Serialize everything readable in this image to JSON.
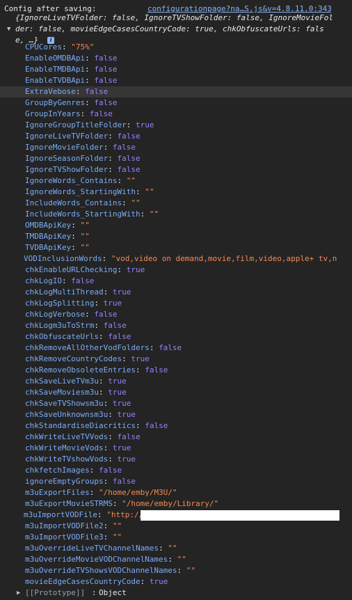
{
  "header": {
    "title": "Config after saving:",
    "source_link": "configurationpage?na…S.js&v=4.8.11.0:343"
  },
  "preview": {
    "line1": "{IgnoreLiveTVFolder: false, IgnoreTVShowFolder: false, IgnoreMovieFol",
    "line2": "der: false, movieEdgeCasesCountryCode: true, chkObfuscateUrls: fals",
    "line3": "e, …}",
    "info_icon": "i"
  },
  "properties": [
    {
      "key": "CPUCores",
      "value": "\"75%\"",
      "type": "str"
    },
    {
      "key": "EnableOMDBApi",
      "value": "false",
      "type": "bool"
    },
    {
      "key": "EnableTMDBApi",
      "value": "false",
      "type": "bool"
    },
    {
      "key": "EnableTVDBApi",
      "value": "false",
      "type": "bool"
    },
    {
      "key": "ExtraVebose",
      "value": "false",
      "type": "bool"
    },
    {
      "key": "GroupByGenres",
      "value": "false",
      "type": "bool"
    },
    {
      "key": "GroupInYears",
      "value": "false",
      "type": "bool"
    },
    {
      "key": "IgnoreGroupTitleFolder",
      "value": "true",
      "type": "bool"
    },
    {
      "key": "IgnoreLiveTVFolder",
      "value": "false",
      "type": "bool"
    },
    {
      "key": "IgnoreMovieFolder",
      "value": "false",
      "type": "bool"
    },
    {
      "key": "IgnoreSeasonFolder",
      "value": "false",
      "type": "bool"
    },
    {
      "key": "IgnoreTVShowFolder",
      "value": "false",
      "type": "bool"
    },
    {
      "key": "IgnoreWords_Contains",
      "value": "\"\"",
      "type": "str"
    },
    {
      "key": "IgnoreWords_StartingWith",
      "value": "\"\"",
      "type": "str"
    },
    {
      "key": "IncludeWords_Contains",
      "value": "\"\"",
      "type": "str"
    },
    {
      "key": "IncludeWords_StartingWith",
      "value": "\"\"",
      "type": "str"
    },
    {
      "key": "OMDBApiKey",
      "value": "\"\"",
      "type": "str"
    },
    {
      "key": "TMDBApiKey",
      "value": "\"\"",
      "type": "str"
    },
    {
      "key": "TVDBApiKey",
      "value": "\"\"",
      "type": "str"
    },
    {
      "key": "VODInclusionWords",
      "value": "\"vod,video on demand,movie,film,video,apple+ tv,n",
      "type": "str"
    },
    {
      "key": "chkEnableURLChecking",
      "value": "true",
      "type": "bool"
    },
    {
      "key": "chkLogIO",
      "value": "false",
      "type": "bool"
    },
    {
      "key": "chkLogMultiThread",
      "value": "true",
      "type": "bool"
    },
    {
      "key": "chkLogSplitting",
      "value": "true",
      "type": "bool"
    },
    {
      "key": "chkLogVerbose",
      "value": "false",
      "type": "bool"
    },
    {
      "key": "chkLogm3uToStrm",
      "value": "false",
      "type": "bool"
    },
    {
      "key": "chkObfuscateUrls",
      "value": "false",
      "type": "bool"
    },
    {
      "key": "chkRemoveAllOtherVodFolders",
      "value": "false",
      "type": "bool"
    },
    {
      "key": "chkRemoveCountryCodes",
      "value": "true",
      "type": "bool"
    },
    {
      "key": "chkRemoveObsoleteEntries",
      "value": "false",
      "type": "bool"
    },
    {
      "key": "chkSaveLiveTVm3u",
      "value": "true",
      "type": "bool"
    },
    {
      "key": "chkSaveMoviesm3u",
      "value": "true",
      "type": "bool"
    },
    {
      "key": "chkSaveTVShowsm3u",
      "value": "true",
      "type": "bool"
    },
    {
      "key": "chkSaveUnknownsm3u",
      "value": "true",
      "type": "bool"
    },
    {
      "key": "chkStandardiseDiacritics",
      "value": "false",
      "type": "bool"
    },
    {
      "key": "chkWriteLiveTVVods",
      "value": "false",
      "type": "bool"
    },
    {
      "key": "chkWriteMovieVods",
      "value": "true",
      "type": "bool"
    },
    {
      "key": "chkWriteTVshowVods",
      "value": "true",
      "type": "bool"
    },
    {
      "key": "chkfetchImages",
      "value": "false",
      "type": "bool"
    },
    {
      "key": "ignoreEmptyGroups",
      "value": "false",
      "type": "bool"
    },
    {
      "key": "m3uExportFiles",
      "value": "\"/home/emby/M3U/\"",
      "type": "str"
    },
    {
      "key": "m3uExportMovieSTRMS",
      "value": "\"/home/emby/Library/\"",
      "type": "str"
    },
    {
      "key": "m3uImportVODFile",
      "value": "\"http://",
      "type": "str"
    },
    {
      "key": "m3uImportVODFile2",
      "value": "\"\"",
      "type": "str"
    },
    {
      "key": "m3uImportVODFile3",
      "value": "\"\"",
      "type": "str"
    },
    {
      "key": "m3uOverrideLiveTVChannelNames",
      "value": "\"\"",
      "type": "str"
    },
    {
      "key": "m3uOverrideMovieVODChannelNames",
      "value": "\"\"",
      "type": "str"
    },
    {
      "key": "m3uOverrideTVShowsVODChannelNames",
      "value": "\"\"",
      "type": "str"
    },
    {
      "key": "movieEdgeCasesCountryCode",
      "value": "true",
      "type": "bool"
    }
  ],
  "prototype": {
    "label": "[[Prototype]]",
    "value": "Object"
  },
  "colors": {
    "background": "#242424",
    "key": "#7cacf8",
    "string": "#f28b54",
    "boolean": "#9980ff",
    "link": "#8ab4f8",
    "highlight_row": "#363636"
  }
}
